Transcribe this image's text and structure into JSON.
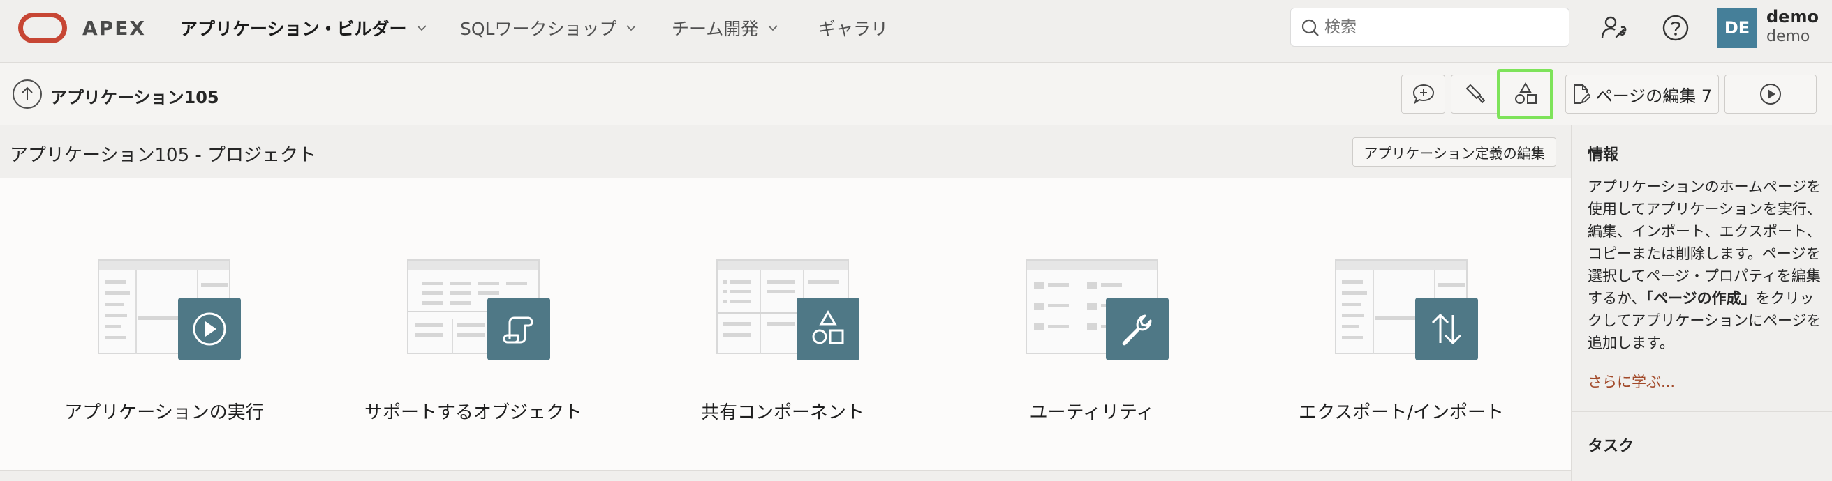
{
  "header": {
    "brand": "APEX",
    "nav": [
      {
        "label": "アプリケーション・ビルダー",
        "active": true,
        "has_menu": true
      },
      {
        "label": "SQLワークショップ",
        "active": false,
        "has_menu": true
      },
      {
        "label": "チーム開発",
        "active": false,
        "has_menu": true
      },
      {
        "label": "ギャラリ",
        "active": false,
        "has_menu": false
      }
    ],
    "search_placeholder": "検索",
    "icons": [
      "administration-icon",
      "help-icon"
    ],
    "user": {
      "initials": "DE",
      "name": "demo",
      "workspace": "demo"
    }
  },
  "toolbar": {
    "breadcrumb": "アプリケーション105",
    "buttons": {
      "comments": "comment-icon",
      "utilities": "brush-icon",
      "shared_components": "shapes-icon",
      "edit_page": "ページの編集 7",
      "run": "run-icon"
    }
  },
  "region": {
    "title": "アプリケーション105 - プロジェクト",
    "edit_button": "アプリケーション定義の編集"
  },
  "tiles": [
    {
      "label": "アプリケーションの実行",
      "icon": "play-icon"
    },
    {
      "label": "サポートするオブジェクト",
      "icon": "scroll-icon"
    },
    {
      "label": "共有コンポーネント",
      "icon": "shapes-icon"
    },
    {
      "label": "ユーティリティ",
      "icon": "wrench-icon"
    },
    {
      "label": "エクスポート/インポート",
      "icon": "transfer-icon"
    }
  ],
  "sidebar": {
    "info_heading": "情報",
    "info_pre": "アプリケーションのホームページを使用してアプリケーションを実行、編集、インポート、エクスポート、コピーまたは削除します。ページを選択してページ・プロパティを編集するか、",
    "info_bold": "「ページの作成」",
    "info_post": "をクリックしてアプリケーションにページを追加します。",
    "learn_more": "さらに学ぶ...",
    "tasks_heading": "タスク"
  },
  "colors": {
    "brand_red": "#c74634",
    "avatar": "#457f99",
    "tile_badge": "#4f7886",
    "highlight": "#7ee35a",
    "link": "#a24a2a"
  }
}
